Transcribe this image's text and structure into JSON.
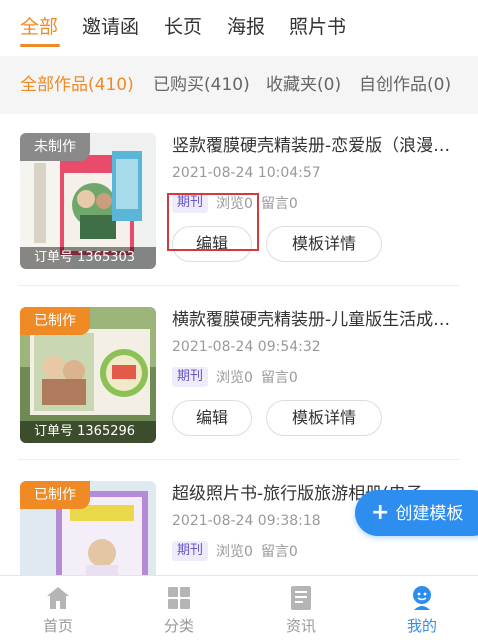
{
  "top_tabs": [
    {
      "label": "全部",
      "active": true
    },
    {
      "label": "邀请函",
      "active": false
    },
    {
      "label": "长页",
      "active": false
    },
    {
      "label": "海报",
      "active": false
    },
    {
      "label": "照片书",
      "active": false
    }
  ],
  "filters": [
    {
      "label": "全部作品(410)",
      "active": true
    },
    {
      "label": "已购买(410)",
      "active": false
    },
    {
      "label": "收藏夹(0)",
      "active": false
    },
    {
      "label": "自创作品(0)",
      "active": false
    }
  ],
  "works": [
    {
      "status": "未制作",
      "order": "订单号 1365303",
      "title": "竖款覆膜硬壳精装册-恋爱版（浪漫爱恋）",
      "date": "2021-08-24 10:04:57",
      "badge": "期刊",
      "views": "浏览0",
      "comments": "留言0",
      "edit_label": "编辑",
      "detail_label": "模板详情"
    },
    {
      "status": "已制作",
      "order": "订单号 1365296",
      "title": "横款覆膜硬壳精装册-儿童版生活成长记",
      "date": "2021-08-24 09:54:32",
      "badge": "期刊",
      "views": "浏览0",
      "comments": "留言0",
      "edit_label": "编辑",
      "detail_label": "模板详情"
    },
    {
      "status": "已制作",
      "order": "",
      "title": "超级照片书-旅行版旅游相册(电子",
      "date": "2021-08-24 09:38:18",
      "badge": "期刊",
      "views": "浏览0",
      "comments": "留言0"
    }
  ],
  "fab": {
    "label": "创建模板",
    "icon": "plus-icon"
  },
  "bottom_nav": [
    {
      "label": "首页",
      "icon": "home-icon",
      "active": false
    },
    {
      "label": "分类",
      "icon": "grid-icon",
      "active": false
    },
    {
      "label": "资讯",
      "icon": "news-icon",
      "active": false
    },
    {
      "label": "我的",
      "icon": "user-icon",
      "active": true
    }
  ],
  "colors": {
    "accent": "#f08a24",
    "primary_blue": "#2e8ef0",
    "badge_purple": "#6a54c9",
    "highlight_red": "#d23b3b"
  }
}
